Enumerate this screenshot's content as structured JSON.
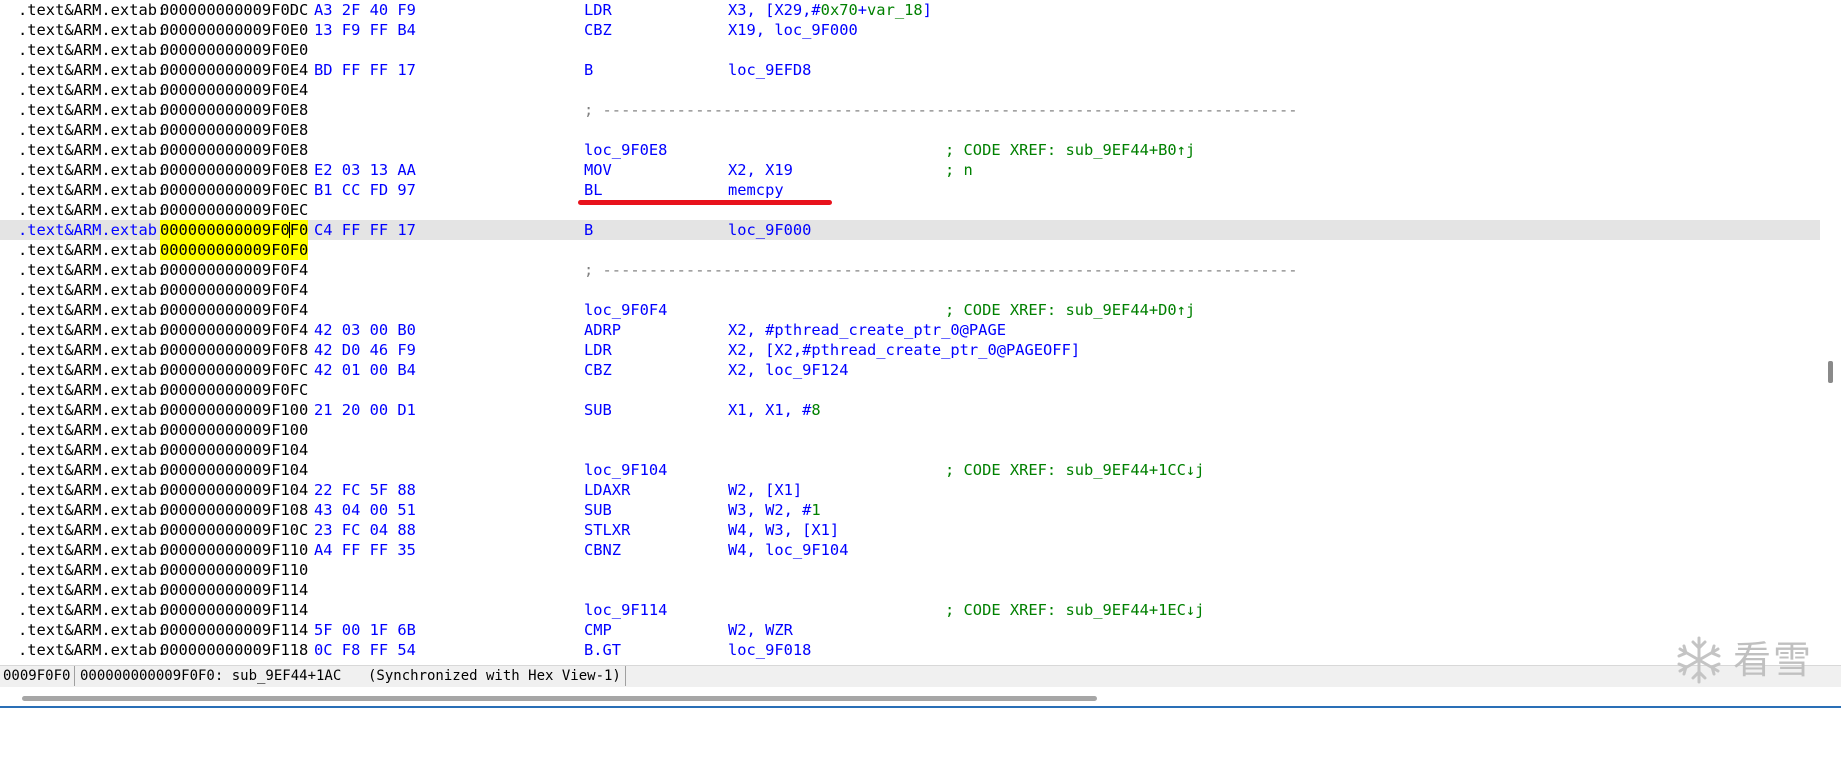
{
  "listing": {
    "segment": ".text&ARM.extab:",
    "lines": [
      {
        "addr": "000000000009F0DC",
        "bytes": "A3 2F 40 F9",
        "mnem": "LDR",
        "ops": "X3, [X29,#0x70+var_18]"
      },
      {
        "addr": "000000000009F0E0",
        "bytes": "13 F9 FF B4",
        "mnem": "CBZ",
        "ops": "X19, loc_9F000"
      },
      {
        "addr": "000000000009F0E0"
      },
      {
        "addr": "000000000009F0E4",
        "bytes": "BD FF FF 17",
        "mnem": "B",
        "ops": "loc_9EFD8"
      },
      {
        "addr": "000000000009F0E4"
      },
      {
        "addr": "000000000009F0E8",
        "sep": "; ---------------------------------------------------------------------------"
      },
      {
        "addr": "000000000009F0E8"
      },
      {
        "addr": "000000000009F0E8",
        "label": "loc_9F0E8",
        "comment": "; CODE XREF: sub_9EF44+B0↑j"
      },
      {
        "addr": "000000000009F0E8",
        "bytes": "E2 03 13 AA",
        "mnem": "MOV",
        "ops": "X2, X19",
        "comment": "; n"
      },
      {
        "addr": "000000000009F0EC",
        "bytes": "B1 CC FD 97",
        "mnem": "BL",
        "ops": "memcpy"
      },
      {
        "addr": "000000000009F0EC"
      },
      {
        "addr": "000000000009F0F0",
        "bytes": "C4 FF FF 17",
        "mnem": "B",
        "ops": "loc_9F000",
        "current": true
      },
      {
        "addr": "000000000009F0F0",
        "highlight": true
      },
      {
        "addr": "000000000009F0F4",
        "sep": "; ---------------------------------------------------------------------------"
      },
      {
        "addr": "000000000009F0F4"
      },
      {
        "addr": "000000000009F0F4",
        "label": "loc_9F0F4",
        "comment": "; CODE XREF: sub_9EF44+D0↑j"
      },
      {
        "addr": "000000000009F0F4",
        "bytes": "42 03 00 B0",
        "mnem": "ADRP",
        "ops": "X2, #pthread_create_ptr_0@PAGE"
      },
      {
        "addr": "000000000009F0F8",
        "bytes": "42 D0 46 F9",
        "mnem": "LDR",
        "ops": "X2, [X2,#pthread_create_ptr_0@PAGEOFF]"
      },
      {
        "addr": "000000000009F0FC",
        "bytes": "42 01 00 B4",
        "mnem": "CBZ",
        "ops": "X2, loc_9F124"
      },
      {
        "addr": "000000000009F0FC"
      },
      {
        "addr": "000000000009F100",
        "bytes": "21 20 00 D1",
        "mnem": "SUB",
        "ops": "X1, X1, #8"
      },
      {
        "addr": "000000000009F100"
      },
      {
        "addr": "000000000009F104"
      },
      {
        "addr": "000000000009F104",
        "label": "loc_9F104",
        "comment": "; CODE XREF: sub_9EF44+1CC↓j"
      },
      {
        "addr": "000000000009F104",
        "bytes": "22 FC 5F 88",
        "mnem": "LDAXR",
        "ops": "W2, [X1]"
      },
      {
        "addr": "000000000009F108",
        "bytes": "43 04 00 51",
        "mnem": "SUB",
        "ops": "W3, W2, #1"
      },
      {
        "addr": "000000000009F10C",
        "bytes": "23 FC 04 88",
        "mnem": "STLXR",
        "ops": "W4, W3, [X1]"
      },
      {
        "addr": "000000000009F110",
        "bytes": "A4 FF FF 35",
        "mnem": "CBNZ",
        "ops": "W4, loc_9F104"
      },
      {
        "addr": "000000000009F110"
      },
      {
        "addr": "000000000009F114"
      },
      {
        "addr": "000000000009F114",
        "label": "loc_9F114",
        "comment": "; CODE XREF: sub_9EF44+1EC↓j"
      },
      {
        "addr": "000000000009F114",
        "bytes": "5F 00 1F 6B",
        "mnem": "CMP",
        "ops": "W2, WZR"
      },
      {
        "addr": "000000000009F118",
        "bytes": "0C F8 FF 54",
        "mnem": "B.GT",
        "ops": "loc_9F018"
      }
    ]
  },
  "status": {
    "position": "0009F0F0",
    "location": "000000000009F0F0: sub_9EF44+1AC",
    "sync": "(Synchronized with Hex View-1)"
  },
  "watermark": {
    "text": "看雪",
    "icon": "snowflake-icon"
  },
  "colors": {
    "selection_line": "#e4e4e4",
    "highlight": "#ffff00",
    "instruction_blue": "#0000ff",
    "comment_green": "#008000",
    "annotation_red": "#e8121c"
  }
}
